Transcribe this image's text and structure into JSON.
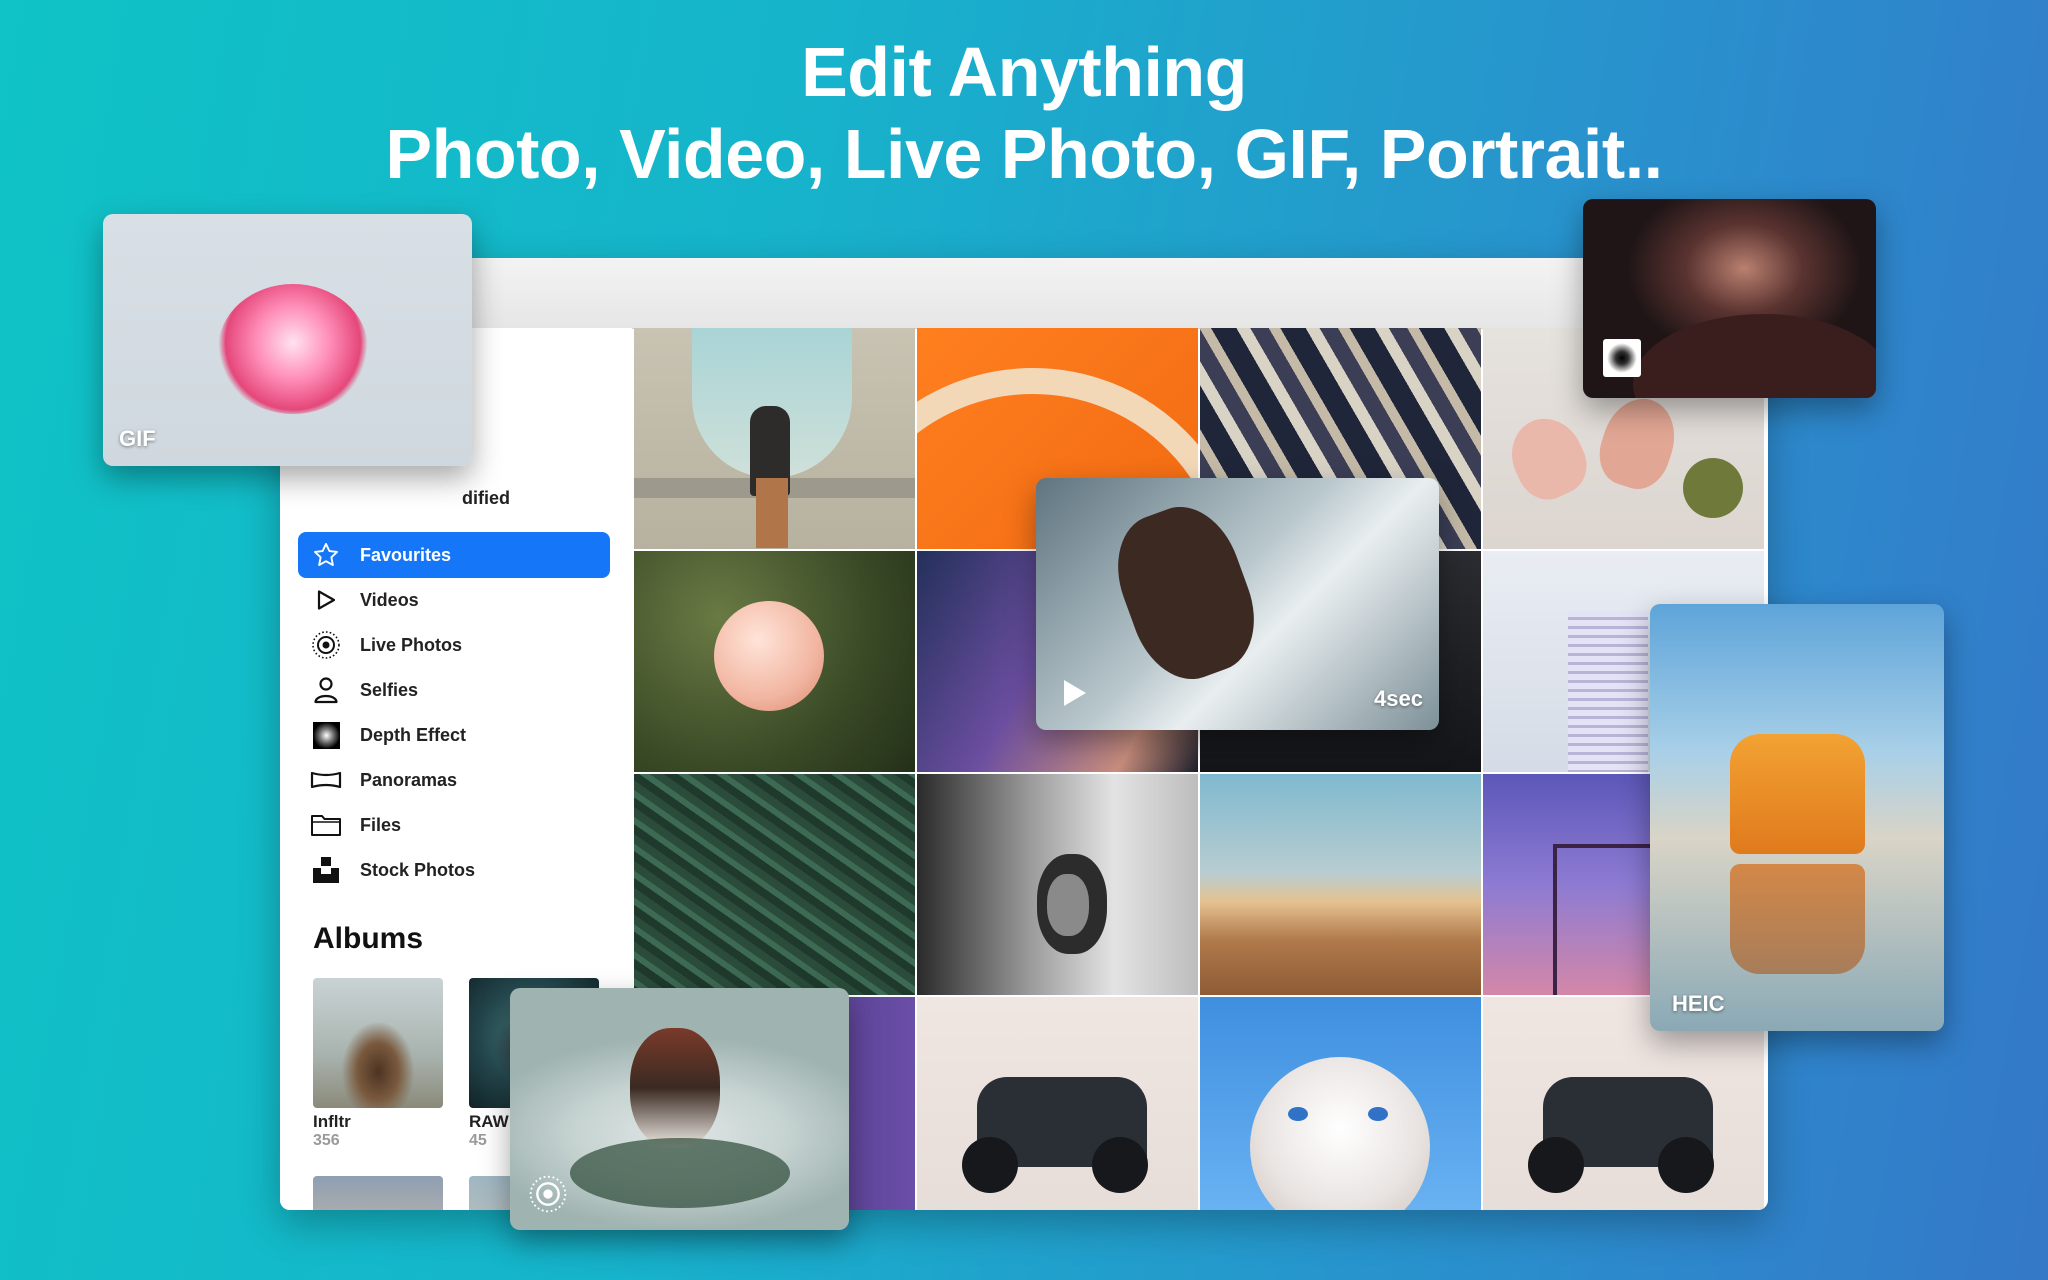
{
  "headline": {
    "line1": "Edit Anything",
    "line2": "Photo, Video, Live Photo, GIF, Portrait.."
  },
  "sidebar": {
    "partial_item": "dified",
    "items": [
      {
        "label": "Favourites",
        "icon": "star-icon",
        "active": true
      },
      {
        "label": "Videos",
        "icon": "play-icon"
      },
      {
        "label": "Live Photos",
        "icon": "live-photo-icon"
      },
      {
        "label": "Selfies",
        "icon": "person-icon"
      },
      {
        "label": "Depth Effect",
        "icon": "depth-effect-icon"
      },
      {
        "label": "Panoramas",
        "icon": "panorama-icon"
      },
      {
        "label": "Files",
        "icon": "folder-icon"
      },
      {
        "label": "Stock Photos",
        "icon": "stock-photos-icon"
      }
    ],
    "albums_title": "Albums",
    "albums": [
      {
        "name": "Infltr",
        "count": "356"
      },
      {
        "name": "RAW",
        "count": "45"
      }
    ]
  },
  "cards": {
    "gif_label": "GIF",
    "video_duration": "4sec",
    "heic_label": "HEIC"
  },
  "colors": {
    "accent": "#1577f7",
    "background_start": "#0fc3c6",
    "background_end": "#3478c8"
  }
}
